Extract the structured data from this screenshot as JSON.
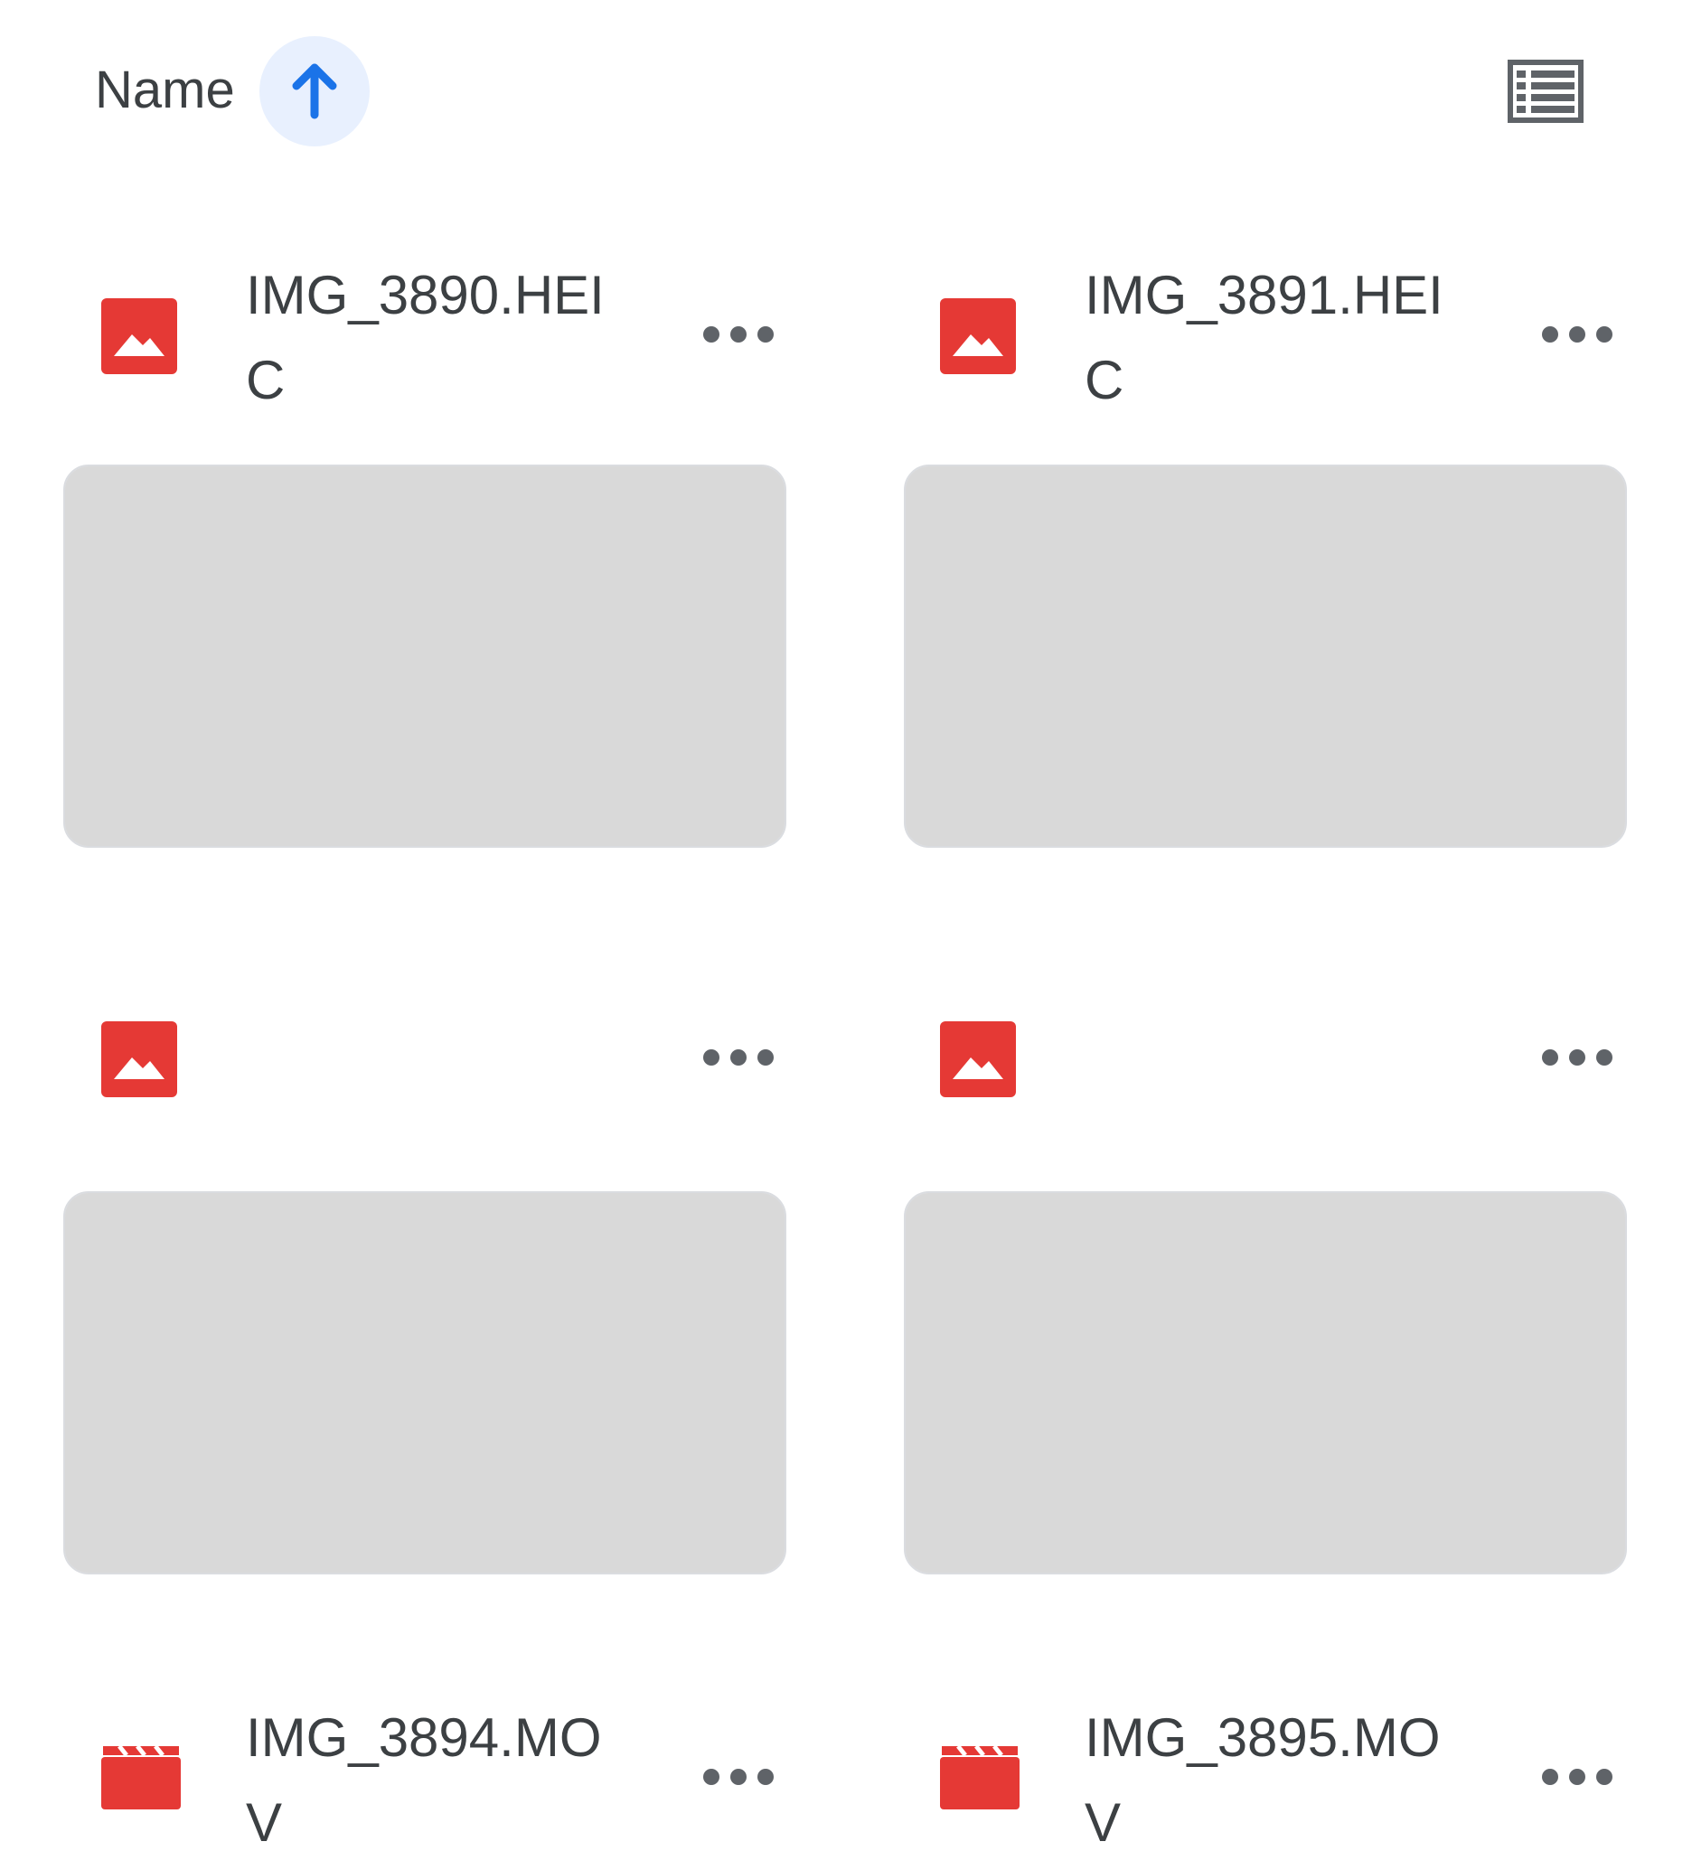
{
  "sort": {
    "label": "Name",
    "direction_icon": "arrow-up-icon",
    "view_icon": "list-view-icon"
  },
  "files": [
    {
      "name": "IMG_3890.HEIC",
      "type_icon": "image-file-icon",
      "menu_icon": "more-horizontal-icon"
    },
    {
      "name": "IMG_3891.HEIC",
      "type_icon": "image-file-icon",
      "menu_icon": "more-horizontal-icon"
    },
    {
      "name": "",
      "type_icon": "image-file-icon",
      "menu_icon": "more-horizontal-icon"
    },
    {
      "name": "",
      "type_icon": "image-file-icon",
      "menu_icon": "more-horizontal-icon"
    },
    {
      "name": "IMG_3894.MOV",
      "type_icon": "video-file-icon",
      "menu_icon": "more-horizontal-icon"
    },
    {
      "name": "IMG_3895.MOV",
      "type_icon": "video-file-icon",
      "menu_icon": "more-horizontal-icon"
    }
  ],
  "colors": {
    "accent": "#1a73e8",
    "accent_bg": "#e8f0fe",
    "file_icon_red": "#e53935",
    "text": "#3c4043",
    "icon_gray": "#5f6368"
  }
}
